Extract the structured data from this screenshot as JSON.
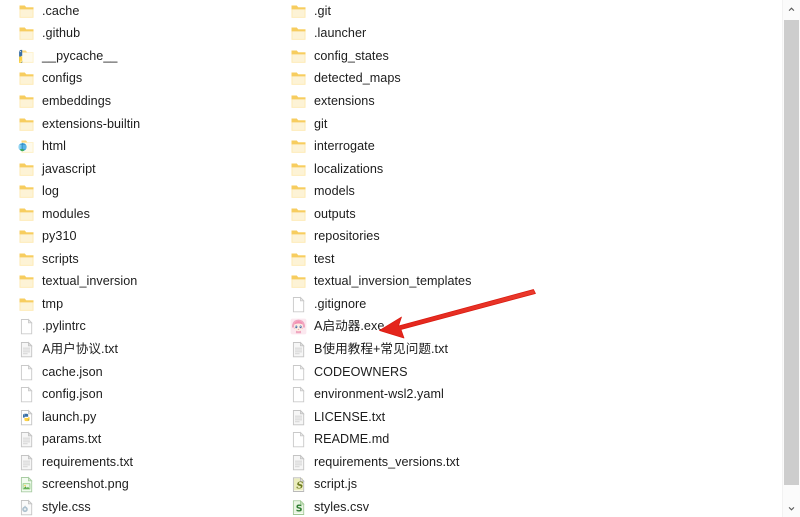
{
  "window": {
    "type": "file-explorer-listing",
    "background_color": "#ffffff",
    "text_color": "#1c1c1c"
  },
  "scrollbar": {
    "up_arrow": "⌃",
    "down_arrow": "⌄",
    "track_color": "#fbfbfb",
    "thumb_color": "#cdcdcd",
    "orientation": "vertical"
  },
  "annotation": {
    "type": "arrow",
    "color": "#e8261b",
    "points_to": "A启动器.exe",
    "direction": "upper-right-to-lower-left"
  },
  "columns": {
    "left": [
      {
        "name": ".cache",
        "icon": "folder-icon",
        "kind": "folder"
      },
      {
        "name": ".github",
        "icon": "folder-icon",
        "kind": "folder"
      },
      {
        "name": "__pycache__",
        "icon": "folder-python-icon",
        "kind": "folder"
      },
      {
        "name": "configs",
        "icon": "folder-icon",
        "kind": "folder"
      },
      {
        "name": "embeddings",
        "icon": "folder-icon",
        "kind": "folder"
      },
      {
        "name": "extensions-builtin",
        "icon": "folder-icon",
        "kind": "folder"
      },
      {
        "name": "html",
        "icon": "folder-html-icon",
        "kind": "folder"
      },
      {
        "name": "javascript",
        "icon": "folder-icon",
        "kind": "folder"
      },
      {
        "name": "log",
        "icon": "folder-icon",
        "kind": "folder"
      },
      {
        "name": "modules",
        "icon": "folder-icon",
        "kind": "folder"
      },
      {
        "name": "py310",
        "icon": "folder-icon",
        "kind": "folder"
      },
      {
        "name": "scripts",
        "icon": "folder-icon",
        "kind": "folder"
      },
      {
        "name": "textual_inversion",
        "icon": "folder-icon",
        "kind": "folder"
      },
      {
        "name": "tmp",
        "icon": "folder-icon",
        "kind": "folder"
      },
      {
        "name": ".pylintrc",
        "icon": "file-blank-icon",
        "kind": "file"
      },
      {
        "name": "A用户协议.txt",
        "icon": "file-text-icon",
        "kind": "file"
      },
      {
        "name": "cache.json",
        "icon": "file-blank-icon",
        "kind": "file"
      },
      {
        "name": "config.json",
        "icon": "file-blank-icon",
        "kind": "file"
      },
      {
        "name": "launch.py",
        "icon": "file-python-icon",
        "kind": "file"
      },
      {
        "name": "params.txt",
        "icon": "file-text-icon",
        "kind": "file"
      },
      {
        "name": "requirements.txt",
        "icon": "file-text-icon",
        "kind": "file"
      },
      {
        "name": "screenshot.png",
        "icon": "file-image-icon",
        "kind": "file"
      },
      {
        "name": "style.css",
        "icon": "file-css-icon",
        "kind": "file"
      }
    ],
    "right": [
      {
        "name": ".git",
        "icon": "folder-icon",
        "kind": "folder"
      },
      {
        "name": ".launcher",
        "icon": "folder-icon",
        "kind": "folder"
      },
      {
        "name": "config_states",
        "icon": "folder-icon",
        "kind": "folder"
      },
      {
        "name": "detected_maps",
        "icon": "folder-icon",
        "kind": "folder"
      },
      {
        "name": "extensions",
        "icon": "folder-icon",
        "kind": "folder"
      },
      {
        "name": "git",
        "icon": "folder-icon",
        "kind": "folder"
      },
      {
        "name": "interrogate",
        "icon": "folder-icon",
        "kind": "folder"
      },
      {
        "name": "localizations",
        "icon": "folder-icon",
        "kind": "folder"
      },
      {
        "name": "models",
        "icon": "folder-icon",
        "kind": "folder"
      },
      {
        "name": "outputs",
        "icon": "folder-icon",
        "kind": "folder"
      },
      {
        "name": "repositories",
        "icon": "folder-icon",
        "kind": "folder"
      },
      {
        "name": "test",
        "icon": "folder-icon",
        "kind": "folder"
      },
      {
        "name": "textual_inversion_templates",
        "icon": "folder-icon",
        "kind": "folder"
      },
      {
        "name": ".gitignore",
        "icon": "file-blank-icon",
        "kind": "file"
      },
      {
        "name": "A启动器.exe",
        "icon": "app-anime-icon",
        "kind": "application"
      },
      {
        "name": "B使用教程+常见问题.txt",
        "icon": "file-text-icon",
        "kind": "file"
      },
      {
        "name": "CODEOWNERS",
        "icon": "file-blank-icon",
        "kind": "file"
      },
      {
        "name": "environment-wsl2.yaml",
        "icon": "file-blank-icon",
        "kind": "file"
      },
      {
        "name": "LICENSE.txt",
        "icon": "file-text-icon",
        "kind": "file"
      },
      {
        "name": "README.md",
        "icon": "file-blank-icon",
        "kind": "file"
      },
      {
        "name": "requirements_versions.txt",
        "icon": "file-text-icon",
        "kind": "file"
      },
      {
        "name": "script.js",
        "icon": "file-js-icon",
        "kind": "file"
      },
      {
        "name": "styles.csv",
        "icon": "file-csv-icon",
        "kind": "file"
      }
    ]
  }
}
